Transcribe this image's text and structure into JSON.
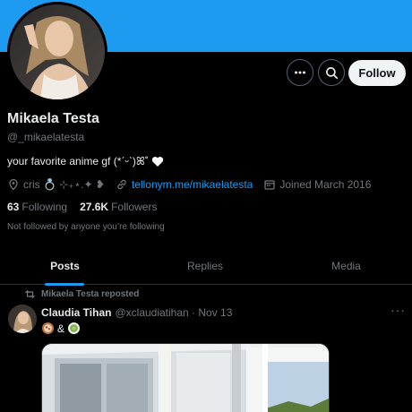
{
  "colors": {
    "banner": "#1d9bf0",
    "accent": "#1d9bf0",
    "background": "#000000",
    "muted": "#71767b"
  },
  "header": {
    "more_icon": "more-horizontal-icon",
    "search_icon": "search-icon",
    "follow_label": "Follow"
  },
  "profile": {
    "name": "Mikaela Testa",
    "handle": "@_mikaelatesta",
    "bio": "your favorite anime gf (*ˊᵕˋ)ꕤ˚",
    "location": "cris 💍 ⊹₊⋆.✦ ❥",
    "link": "tellonym.me/mikaelatesta",
    "joined": "Joined March 2016",
    "following_count": "63",
    "following_label": "Following",
    "followers_count": "27.6K",
    "followers_label": "Followers",
    "not_followed": "Not followed by anyone you’re following"
  },
  "tabs": [
    {
      "label": "Posts",
      "active": true
    },
    {
      "label": "Replies",
      "active": false
    },
    {
      "label": "Media",
      "active": false
    }
  ],
  "tweet": {
    "repost_label": "Mikaela Testa reposted",
    "author": "Claudia Tihan",
    "handle_date": "@xclaudiatihan · Nov 13",
    "text_mid": "&",
    "more": "···"
  }
}
